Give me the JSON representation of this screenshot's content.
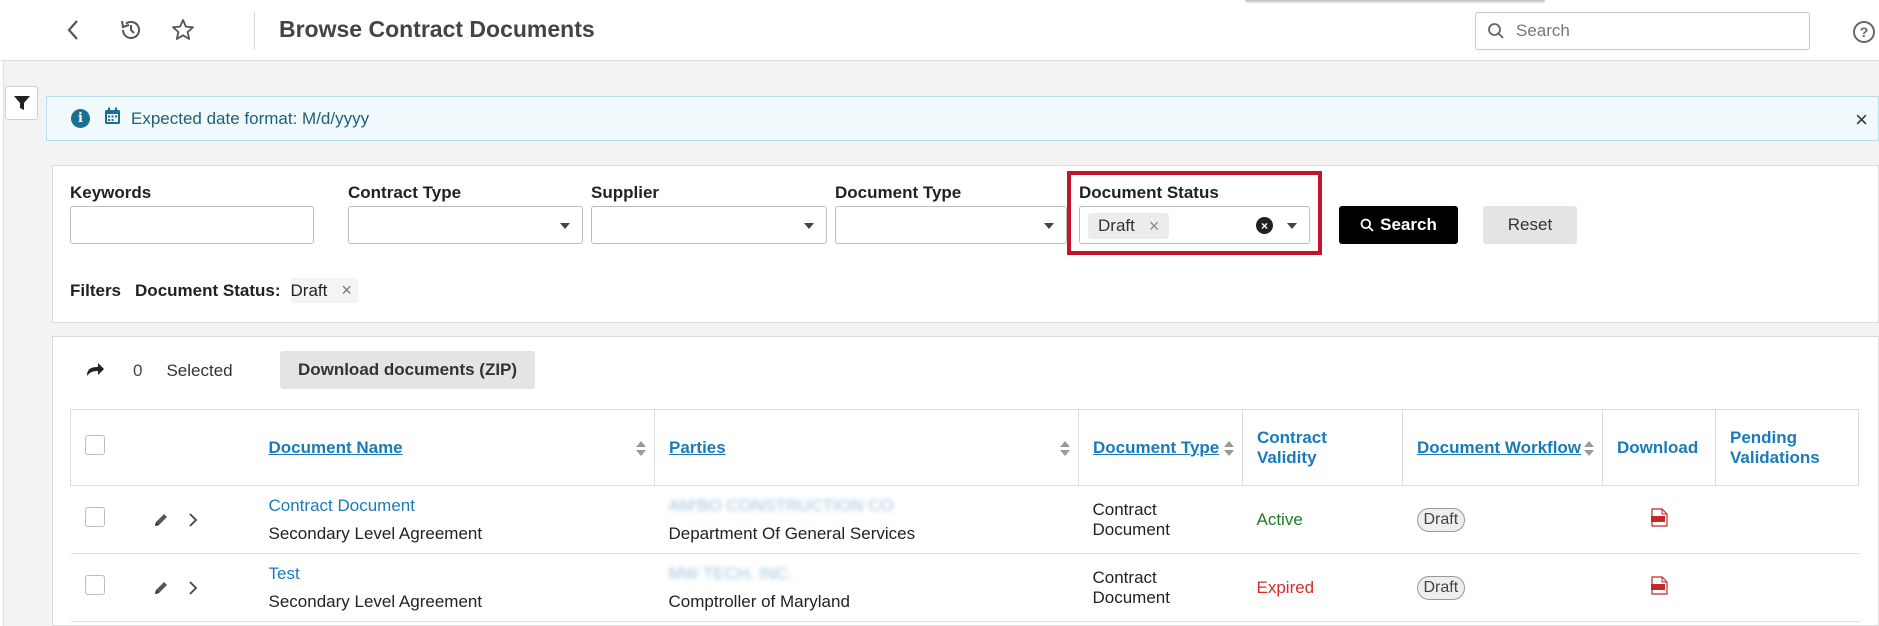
{
  "header": {
    "title": "Browse Contract Documents",
    "search_placeholder": "Search",
    "help_glyph": "?"
  },
  "banner": {
    "info_glyph": "i",
    "text": "Expected date format: M/d/yyyy",
    "close_glyph": "×"
  },
  "filters": {
    "keywords_label": "Keywords",
    "contract_type_label": "Contract Type",
    "supplier_label": "Supplier",
    "document_type_label": "Document Type",
    "document_status_label": "Document Status",
    "document_status_value": "Draft",
    "chip_remove_glyph": "×",
    "clear_glyph": "×",
    "search_label": "Search",
    "reset_label": "Reset",
    "applied_title": "Filters",
    "applied_name": "Document Status:",
    "applied_value": "Draft"
  },
  "results_toolbar": {
    "selected_count": "0",
    "selected_label": "Selected",
    "download_zip_label": "Download documents (ZIP)"
  },
  "table": {
    "columns": {
      "document_name": "Document Name",
      "parties": "Parties",
      "document_type": "Document Type",
      "contract_validity": "Contract Validity",
      "document_workflow": "Document Workflow",
      "download": "Download",
      "pending_validations": "Pending Validations"
    },
    "rows": [
      {
        "name": "Contract Document",
        "agreement": "Secondary Level Agreement",
        "party_redacted": "AM'BO CONSTRUCTION CO",
        "party": "Department Of General Services",
        "doc_type": "Contract Document",
        "validity": "Active",
        "workflow": "Draft"
      },
      {
        "name": "Test",
        "agreement": "Secondary Level Agreement",
        "party_redacted": "MW TECH, INC.",
        "party": "Comptroller of Maryland",
        "doc_type": "Contract Document",
        "validity": "Expired",
        "workflow": "Draft"
      }
    ]
  },
  "colors": {
    "accent": "#1b7bb8",
    "highlight": "#c4122f",
    "active": "#1e7d1e",
    "expired": "#d62c2c"
  },
  "icons": [
    "back-icon",
    "history-icon",
    "star-icon",
    "search-icon",
    "help-icon",
    "filter-icon",
    "info-icon",
    "calendar-icon",
    "close-icon",
    "share-icon",
    "edit-icon",
    "chevron-right-icon",
    "pdf-icon",
    "sort-icon"
  ]
}
